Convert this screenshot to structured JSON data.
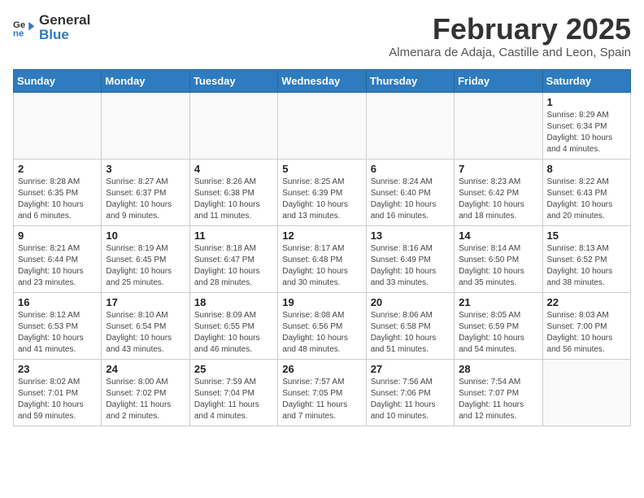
{
  "header": {
    "logo_general": "General",
    "logo_blue": "Blue",
    "title": "February 2025",
    "subtitle": "Almenara de Adaja, Castille and Leon, Spain"
  },
  "weekdays": [
    "Sunday",
    "Monday",
    "Tuesday",
    "Wednesday",
    "Thursday",
    "Friday",
    "Saturday"
  ],
  "weeks": [
    [
      {
        "day": "",
        "info": ""
      },
      {
        "day": "",
        "info": ""
      },
      {
        "day": "",
        "info": ""
      },
      {
        "day": "",
        "info": ""
      },
      {
        "day": "",
        "info": ""
      },
      {
        "day": "",
        "info": ""
      },
      {
        "day": "1",
        "info": "Sunrise: 8:29 AM\nSunset: 6:34 PM\nDaylight: 10 hours\nand 4 minutes."
      }
    ],
    [
      {
        "day": "2",
        "info": "Sunrise: 8:28 AM\nSunset: 6:35 PM\nDaylight: 10 hours\nand 6 minutes."
      },
      {
        "day": "3",
        "info": "Sunrise: 8:27 AM\nSunset: 6:37 PM\nDaylight: 10 hours\nand 9 minutes."
      },
      {
        "day": "4",
        "info": "Sunrise: 8:26 AM\nSunset: 6:38 PM\nDaylight: 10 hours\nand 11 minutes."
      },
      {
        "day": "5",
        "info": "Sunrise: 8:25 AM\nSunset: 6:39 PM\nDaylight: 10 hours\nand 13 minutes."
      },
      {
        "day": "6",
        "info": "Sunrise: 8:24 AM\nSunset: 6:40 PM\nDaylight: 10 hours\nand 16 minutes."
      },
      {
        "day": "7",
        "info": "Sunrise: 8:23 AM\nSunset: 6:42 PM\nDaylight: 10 hours\nand 18 minutes."
      },
      {
        "day": "8",
        "info": "Sunrise: 8:22 AM\nSunset: 6:43 PM\nDaylight: 10 hours\nand 20 minutes."
      }
    ],
    [
      {
        "day": "9",
        "info": "Sunrise: 8:21 AM\nSunset: 6:44 PM\nDaylight: 10 hours\nand 23 minutes."
      },
      {
        "day": "10",
        "info": "Sunrise: 8:19 AM\nSunset: 6:45 PM\nDaylight: 10 hours\nand 25 minutes."
      },
      {
        "day": "11",
        "info": "Sunrise: 8:18 AM\nSunset: 6:47 PM\nDaylight: 10 hours\nand 28 minutes."
      },
      {
        "day": "12",
        "info": "Sunrise: 8:17 AM\nSunset: 6:48 PM\nDaylight: 10 hours\nand 30 minutes."
      },
      {
        "day": "13",
        "info": "Sunrise: 8:16 AM\nSunset: 6:49 PM\nDaylight: 10 hours\nand 33 minutes."
      },
      {
        "day": "14",
        "info": "Sunrise: 8:14 AM\nSunset: 6:50 PM\nDaylight: 10 hours\nand 35 minutes."
      },
      {
        "day": "15",
        "info": "Sunrise: 8:13 AM\nSunset: 6:52 PM\nDaylight: 10 hours\nand 38 minutes."
      }
    ],
    [
      {
        "day": "16",
        "info": "Sunrise: 8:12 AM\nSunset: 6:53 PM\nDaylight: 10 hours\nand 41 minutes."
      },
      {
        "day": "17",
        "info": "Sunrise: 8:10 AM\nSunset: 6:54 PM\nDaylight: 10 hours\nand 43 minutes."
      },
      {
        "day": "18",
        "info": "Sunrise: 8:09 AM\nSunset: 6:55 PM\nDaylight: 10 hours\nand 46 minutes."
      },
      {
        "day": "19",
        "info": "Sunrise: 8:08 AM\nSunset: 6:56 PM\nDaylight: 10 hours\nand 48 minutes."
      },
      {
        "day": "20",
        "info": "Sunrise: 8:06 AM\nSunset: 6:58 PM\nDaylight: 10 hours\nand 51 minutes."
      },
      {
        "day": "21",
        "info": "Sunrise: 8:05 AM\nSunset: 6:59 PM\nDaylight: 10 hours\nand 54 minutes."
      },
      {
        "day": "22",
        "info": "Sunrise: 8:03 AM\nSunset: 7:00 PM\nDaylight: 10 hours\nand 56 minutes."
      }
    ],
    [
      {
        "day": "23",
        "info": "Sunrise: 8:02 AM\nSunset: 7:01 PM\nDaylight: 10 hours\nand 59 minutes."
      },
      {
        "day": "24",
        "info": "Sunrise: 8:00 AM\nSunset: 7:02 PM\nDaylight: 11 hours\nand 2 minutes."
      },
      {
        "day": "25",
        "info": "Sunrise: 7:59 AM\nSunset: 7:04 PM\nDaylight: 11 hours\nand 4 minutes."
      },
      {
        "day": "26",
        "info": "Sunrise: 7:57 AM\nSunset: 7:05 PM\nDaylight: 11 hours\nand 7 minutes."
      },
      {
        "day": "27",
        "info": "Sunrise: 7:56 AM\nSunset: 7:06 PM\nDaylight: 11 hours\nand 10 minutes."
      },
      {
        "day": "28",
        "info": "Sunrise: 7:54 AM\nSunset: 7:07 PM\nDaylight: 11 hours\nand 12 minutes."
      },
      {
        "day": "",
        "info": ""
      }
    ]
  ]
}
